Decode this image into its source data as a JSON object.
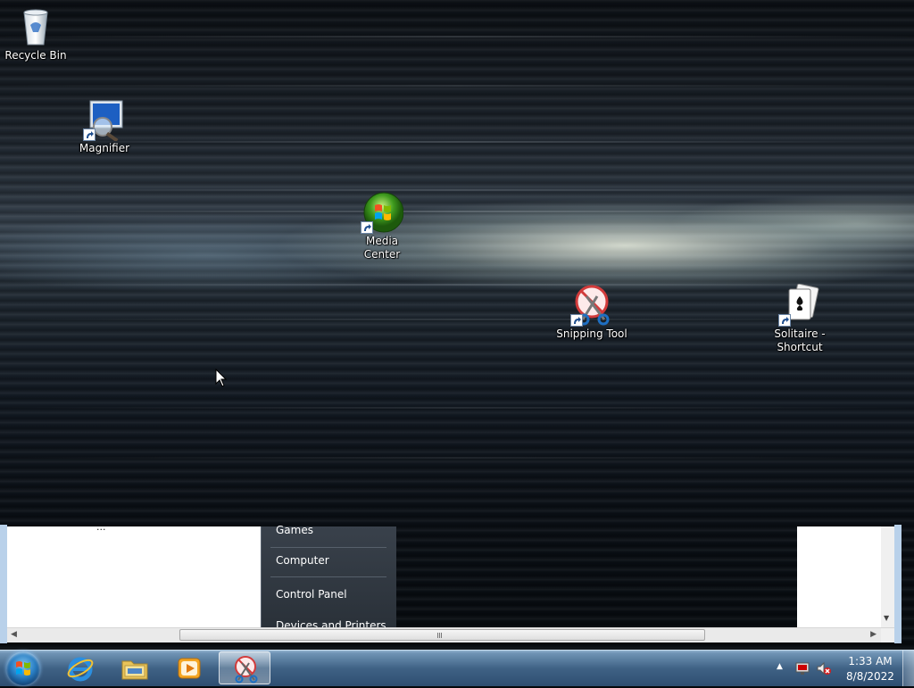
{
  "desktop": {
    "icons": [
      {
        "label": "Recycle Bin",
        "icon": "recycle-bin-icon"
      },
      {
        "label": "Magnifier",
        "icon": "magnifier-icon"
      },
      {
        "label": "Media Center",
        "icon": "media-center-icon"
      },
      {
        "label": "Snipping Tool",
        "icon": "snipping-tool-icon"
      },
      {
        "label": "Solitaire -",
        "label2": "Shortcut",
        "icon": "solitaire-icon"
      }
    ]
  },
  "window": {
    "clipped_text": "...",
    "start_menu_items": [
      "Games",
      "Computer",
      "Control Panel",
      "Devices and Printers"
    ]
  },
  "taskbar": {
    "start": "start-orb-icon",
    "pinned": [
      {
        "name": "internet-explorer-icon"
      },
      {
        "name": "windows-explorer-icon"
      },
      {
        "name": "media-player-icon"
      },
      {
        "name": "snipping-tool-icon",
        "active": true
      }
    ],
    "clock": {
      "time": "1:33 AM",
      "date": "8/8/2022"
    }
  },
  "colors": {
    "taskbar_top": "#6f93b4",
    "taskbar_bottom": "#2e4e70",
    "window_border": "#b9d1ea"
  }
}
